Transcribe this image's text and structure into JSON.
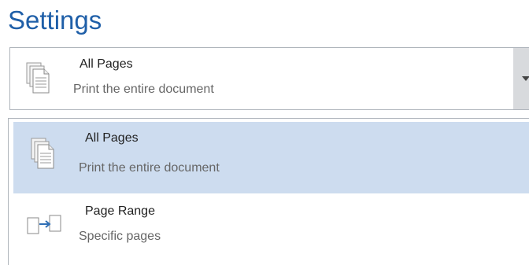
{
  "heading": "Settings",
  "combo": {
    "title": "All Pages",
    "subtitle": "Print the entire document",
    "icon": "stacked-pages-icon"
  },
  "options": [
    {
      "title": "All Pages",
      "subtitle": "Print the entire document",
      "icon": "stacked-pages-icon",
      "selected": true
    },
    {
      "title": "Page Range",
      "subtitle": "Specific pages",
      "icon": "page-range-icon",
      "selected": false
    }
  ],
  "colors": {
    "heading": "#1f5fa8",
    "selected_bg": "#cddcef",
    "arrow_bg": "#d8dadd",
    "range_arrow": "#2f6fb5"
  }
}
